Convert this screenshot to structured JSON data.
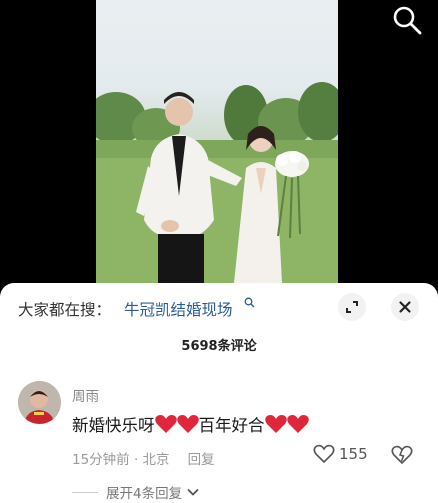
{
  "sheet": {
    "search_prefix": "大家都在搜：",
    "search_query": "牛冠凯结婚现场",
    "comment_count": "5698条评论"
  },
  "comment": {
    "username": "周雨",
    "text_part1": "新婚快乐呀",
    "text_part2": "百年好合",
    "time": "15分钟前 · 北京",
    "reply_label": "回复",
    "likes": "155",
    "expand_replies": "展开4条回复"
  },
  "colors": {
    "link": "#2a5c9a",
    "heart": "#e0263a",
    "sheet_bg": "#ffffff"
  },
  "icons": [
    "search-icon",
    "expand-icon",
    "close-icon",
    "heart-icon",
    "thumbs-down-icon",
    "chevron-down-icon"
  ]
}
